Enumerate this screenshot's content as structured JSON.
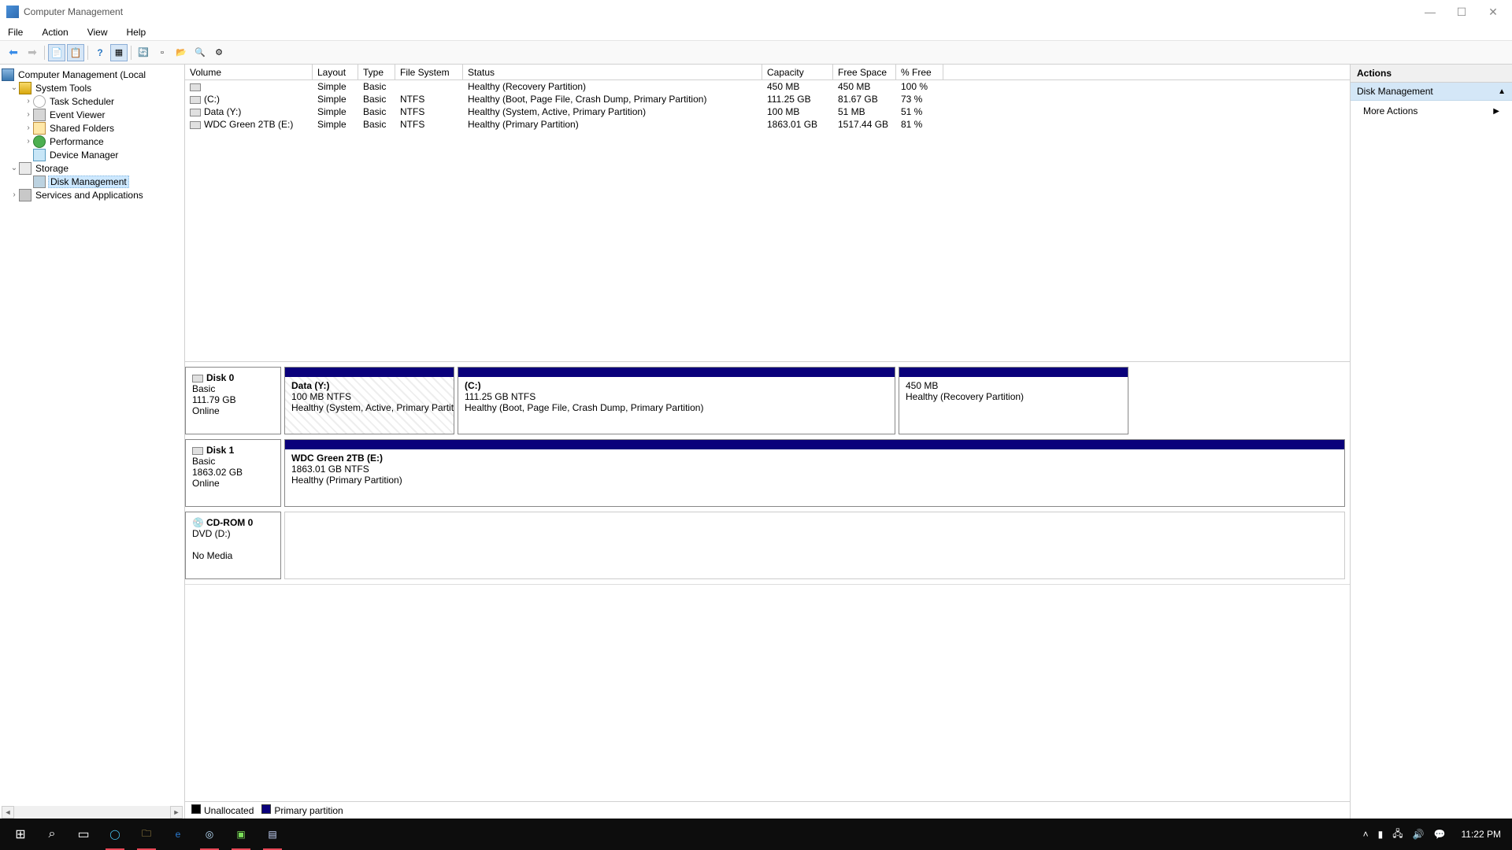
{
  "window": {
    "title": "Computer Management"
  },
  "menu": {
    "file": "File",
    "action": "Action",
    "view": "View",
    "help": "Help"
  },
  "tree": {
    "root": "Computer Management (Local",
    "system_tools": "System Tools",
    "task_scheduler": "Task Scheduler",
    "event_viewer": "Event Viewer",
    "shared_folders": "Shared Folders",
    "performance": "Performance",
    "device_manager": "Device Manager",
    "storage": "Storage",
    "disk_management": "Disk Management",
    "services_apps": "Services and Applications"
  },
  "vol_cols": {
    "volume": "Volume",
    "layout": "Layout",
    "type": "Type",
    "filesystem": "File System",
    "status": "Status",
    "capacity": "Capacity",
    "free": "Free Space",
    "pct": "% Free"
  },
  "volumes": [
    {
      "name": "",
      "layout": "Simple",
      "type": "Basic",
      "fs": "",
      "status": "Healthy (Recovery Partition)",
      "cap": "450 MB",
      "free": "450 MB",
      "pct": "100 %"
    },
    {
      "name": "(C:)",
      "layout": "Simple",
      "type": "Basic",
      "fs": "NTFS",
      "status": "Healthy (Boot, Page File, Crash Dump, Primary Partition)",
      "cap": "111.25 GB",
      "free": "81.67 GB",
      "pct": "73 %"
    },
    {
      "name": "Data (Y:)",
      "layout": "Simple",
      "type": "Basic",
      "fs": "NTFS",
      "status": "Healthy (System, Active, Primary Partition)",
      "cap": "100 MB",
      "free": "51 MB",
      "pct": "51 %"
    },
    {
      "name": "WDC Green 2TB (E:)",
      "layout": "Simple",
      "type": "Basic",
      "fs": "NTFS",
      "status": "Healthy (Primary Partition)",
      "cap": "1863.01 GB",
      "free": "1517.44 GB",
      "pct": "81 %"
    }
  ],
  "disk0": {
    "title": "Disk 0",
    "type": "Basic",
    "size": "111.79 GB",
    "status": "Online",
    "p0": {
      "title": "Data  (Y:)",
      "line2": "100 MB NTFS",
      "line3": "Healthy (System, Active, Primary Partition)"
    },
    "p1": {
      "title": " (C:)",
      "line2": "111.25 GB NTFS",
      "line3": "Healthy (Boot, Page File, Crash Dump, Primary Partition)"
    },
    "p2": {
      "title": "",
      "line2": "450 MB",
      "line3": "Healthy (Recovery Partition)"
    }
  },
  "disk1": {
    "title": "Disk 1",
    "type": "Basic",
    "size": "1863.02 GB",
    "status": "Online",
    "p0": {
      "title": "WDC Green 2TB  (E:)",
      "line2": "1863.01 GB NTFS",
      "line3": "Healthy (Primary Partition)"
    }
  },
  "cdrom": {
    "title": "CD-ROM 0",
    "line2": "DVD (D:)",
    "line4": "No Media"
  },
  "legend": {
    "unallocated": "Unallocated",
    "primary": "Primary partition"
  },
  "actions": {
    "header": "Actions",
    "section": "Disk Management",
    "more": "More Actions"
  },
  "clock": "11:22 PM"
}
